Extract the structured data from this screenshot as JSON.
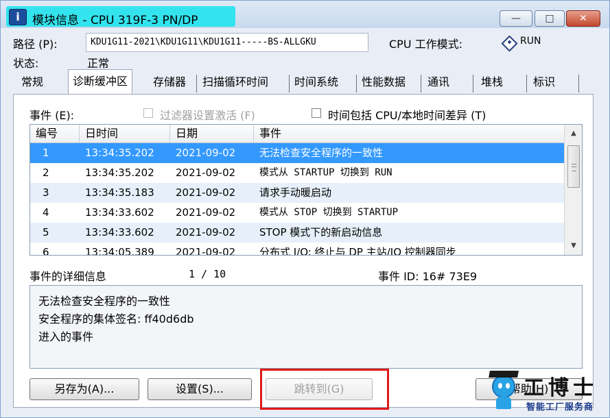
{
  "window": {
    "title": "模块信息 - CPU 319F-3 PN/DP",
    "icon": "info-icon",
    "controls": {
      "minimize": "—",
      "maximize": "□",
      "close": "✕"
    }
  },
  "header": {
    "path_label": "路径 (P):",
    "path_value": "KDU1G11-2021\\KDU1G11\\KDU1G11-----BS-ALLGKU",
    "status_label": "状态:",
    "status_value": "正常",
    "mode_label": "CPU 工作模式:",
    "mode_value": "RUN",
    "mode_icon": "run-diamond-icon"
  },
  "tabs": [
    {
      "label": "常规",
      "active": false
    },
    {
      "label": "诊断缓冲区",
      "active": true
    },
    {
      "label": "存储器",
      "active": false
    },
    {
      "label": "扫描循环时间",
      "active": false
    },
    {
      "label": "时间系统",
      "active": false
    },
    {
      "label": "性能数据",
      "active": false
    },
    {
      "label": "通讯",
      "active": false
    },
    {
      "label": "堆栈",
      "active": false
    },
    {
      "label": "标识",
      "active": false
    }
  ],
  "events": {
    "label": "事件 (E):",
    "filter_checkbox": "过滤器设置激活 (F)",
    "time_checkbox": "时间包括 CPU/本地时间差异 (T)",
    "columns": [
      "编号",
      "日时间",
      "日期",
      "事件"
    ],
    "rows": [
      {
        "no": "1",
        "time": "13:34:35.202",
        "date": "2021-09-02",
        "event": "无法检查安全程序的一致性"
      },
      {
        "no": "2",
        "time": "13:34:35.202",
        "date": "2021-09-02",
        "event": "模式从 STARTUP 切换到 RUN"
      },
      {
        "no": "3",
        "time": "13:34:35.183",
        "date": "2021-09-02",
        "event": "请求手动暖启动"
      },
      {
        "no": "4",
        "time": "13:34:33.602",
        "date": "2021-09-02",
        "event": "模式从 STOP 切换到 STARTUP"
      },
      {
        "no": "5",
        "time": "13:34:33.602",
        "date": "2021-09-02",
        "event": "STOP 模式下的新启动信息"
      },
      {
        "no": "6",
        "time": "13:34:05.389",
        "date": "2021-09-02",
        "event": "分布式 I/O: 终止与 DP 主站/IO 控制器同步"
      }
    ],
    "selected_index": 0
  },
  "details": {
    "label": "事件的详细信息",
    "counter": "1 / 10",
    "event_id": "事件 ID:  16# 73E9",
    "lines": [
      "无法检查安全程序的一致性",
      "安全程序的集体签名: ff40d6db",
      "进入的事件"
    ]
  },
  "buttons": {
    "save_as": "另存为(A)...",
    "settings": "设置(S)...",
    "goto": "跳转到(G)",
    "help": "帮助(H)"
  },
  "watermark": {
    "title": "工博士",
    "subtitle": "智能工厂服务商"
  },
  "colors": {
    "selection": "#3399ff",
    "title_highlight": "#33e3ee",
    "annotation_box": "#e01818"
  }
}
